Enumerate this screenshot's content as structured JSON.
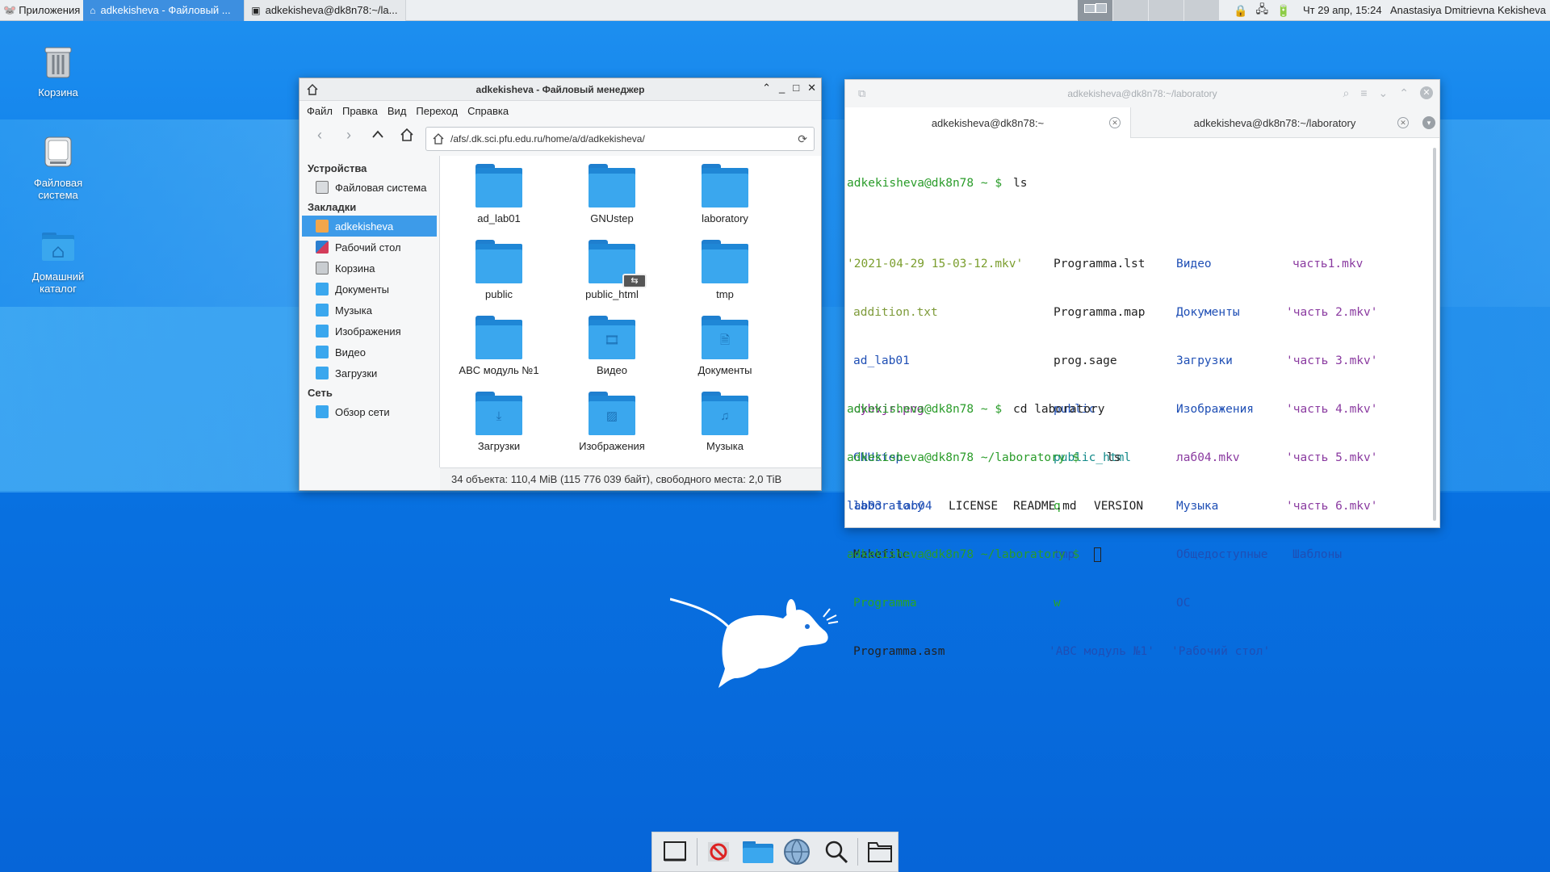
{
  "panel": {
    "apps_menu": "Приложения",
    "tasks": [
      {
        "label": "adkekisheva - Файловый ..."
      },
      {
        "label": "adkekisheva@dk8n78:~/la..."
      }
    ],
    "clock": "Чт 29 апр, 15:24",
    "user": "Anastasiya Dmitrievna Kekisheva"
  },
  "desktop": {
    "icons": [
      {
        "label": "Корзина"
      },
      {
        "label": "Файловая система"
      },
      {
        "label": "Домашний каталог"
      }
    ]
  },
  "file_manager": {
    "title": "adkekisheva - Файловый менеджер",
    "menu": [
      "Файл",
      "Правка",
      "Вид",
      "Переход",
      "Справка"
    ],
    "address": "/afs/.dk.sci.pfu.edu.ru/home/a/d/adkekisheva/",
    "sidebar": {
      "devices_header": "Устройства",
      "devices": [
        {
          "label": "Файловая система"
        }
      ],
      "bookmarks_header": "Закладки",
      "bookmarks": [
        {
          "label": "adkekisheva",
          "selected": true
        },
        {
          "label": "Рабочий стол"
        },
        {
          "label": "Корзина"
        },
        {
          "label": "Документы"
        },
        {
          "label": "Музыка"
        },
        {
          "label": "Изображения"
        },
        {
          "label": "Видео"
        },
        {
          "label": "Загрузки"
        }
      ],
      "network_header": "Сеть",
      "network": [
        {
          "label": "Обзор сети"
        }
      ]
    },
    "items": [
      {
        "label": "ad_lab01"
      },
      {
        "label": "GNUstep"
      },
      {
        "label": "laboratory"
      },
      {
        "label": "public"
      },
      {
        "label": "public_html"
      },
      {
        "label": "tmp"
      },
      {
        "label": "ABC модуль №1"
      },
      {
        "label": "Видео"
      },
      {
        "label": "Документы"
      },
      {
        "label": "Загрузки"
      },
      {
        "label": "Изображения"
      },
      {
        "label": "Музыка"
      }
    ],
    "status": "34 объекта: 110,4 MiB (115 776 039 байт), свободного места: 2,0 TiB"
  },
  "terminal": {
    "title": "adkekisheva@dk8n78:~/laboratory",
    "tabs": [
      {
        "label": "adkekisheva@dk8n78:~"
      },
      {
        "label": "adkekisheva@dk8n78:~/laboratory"
      }
    ],
    "prompt_home": "adkekisheva@dk8n78 ~ $",
    "prompt_lab": "adkekisheva@dk8n78 ~/laboratory $",
    "cmd_ls": "ls",
    "cmd_cd": "cd laboratory",
    "ls_col1": [
      "'2021-04-29 15-03-12.mkv'",
      "addition.txt",
      "ad_lab01",
      "cybvjr.png",
      "GNUstep",
      "laboratory",
      "Makefile",
      "Programma",
      "Programma.asm"
    ],
    "ls_col2": [
      "Programma.lst",
      "Programma.map",
      "prog.sage",
      "public",
      "public_html",
      "q",
      "tmp",
      "w",
      "'ABC модуль №1'"
    ],
    "ls_col3": [
      "Видео",
      "Документы",
      "Загрузки",
      "Изображения",
      "лаб04.mkv",
      "Музыка",
      "Общедоступные",
      "ОС",
      "'Рабочий стол'"
    ],
    "ls_col4": [
      "часть1.mkv",
      "'часть 2.mkv'",
      "'часть 3.mkv'",
      "'часть 4.mkv'",
      "'часть 5.mkv'",
      "'часть 6.mkv'",
      "Шаблоны"
    ],
    "lab_ls": [
      "lab03",
      "lab04",
      "LICENSE",
      "README.md",
      "VERSION"
    ]
  },
  "colors": {
    "accent": "#3d9be9",
    "prompt": "#2a9c2a",
    "directory": "#1f4fb5"
  }
}
